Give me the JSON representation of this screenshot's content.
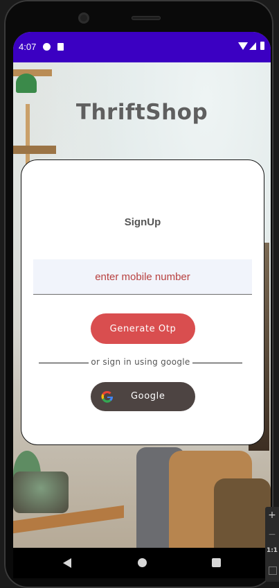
{
  "status_bar": {
    "time": "4:07"
  },
  "app": {
    "brand": "ThriftShop"
  },
  "signup_card": {
    "title": "SignUp",
    "mobile_placeholder": "enter mobile number",
    "otp_button_label": "Generate Otp",
    "divider_text": "or sign in using google",
    "google_button_label": "Google"
  },
  "emulator_zoom": {
    "plus": "+",
    "minus": "−",
    "ratio": "1:1"
  },
  "colors": {
    "status_bar": "#3b00c2",
    "otp_button": "#d94e4f",
    "google_button": "#4d4442",
    "input_text": "#b8403f"
  }
}
